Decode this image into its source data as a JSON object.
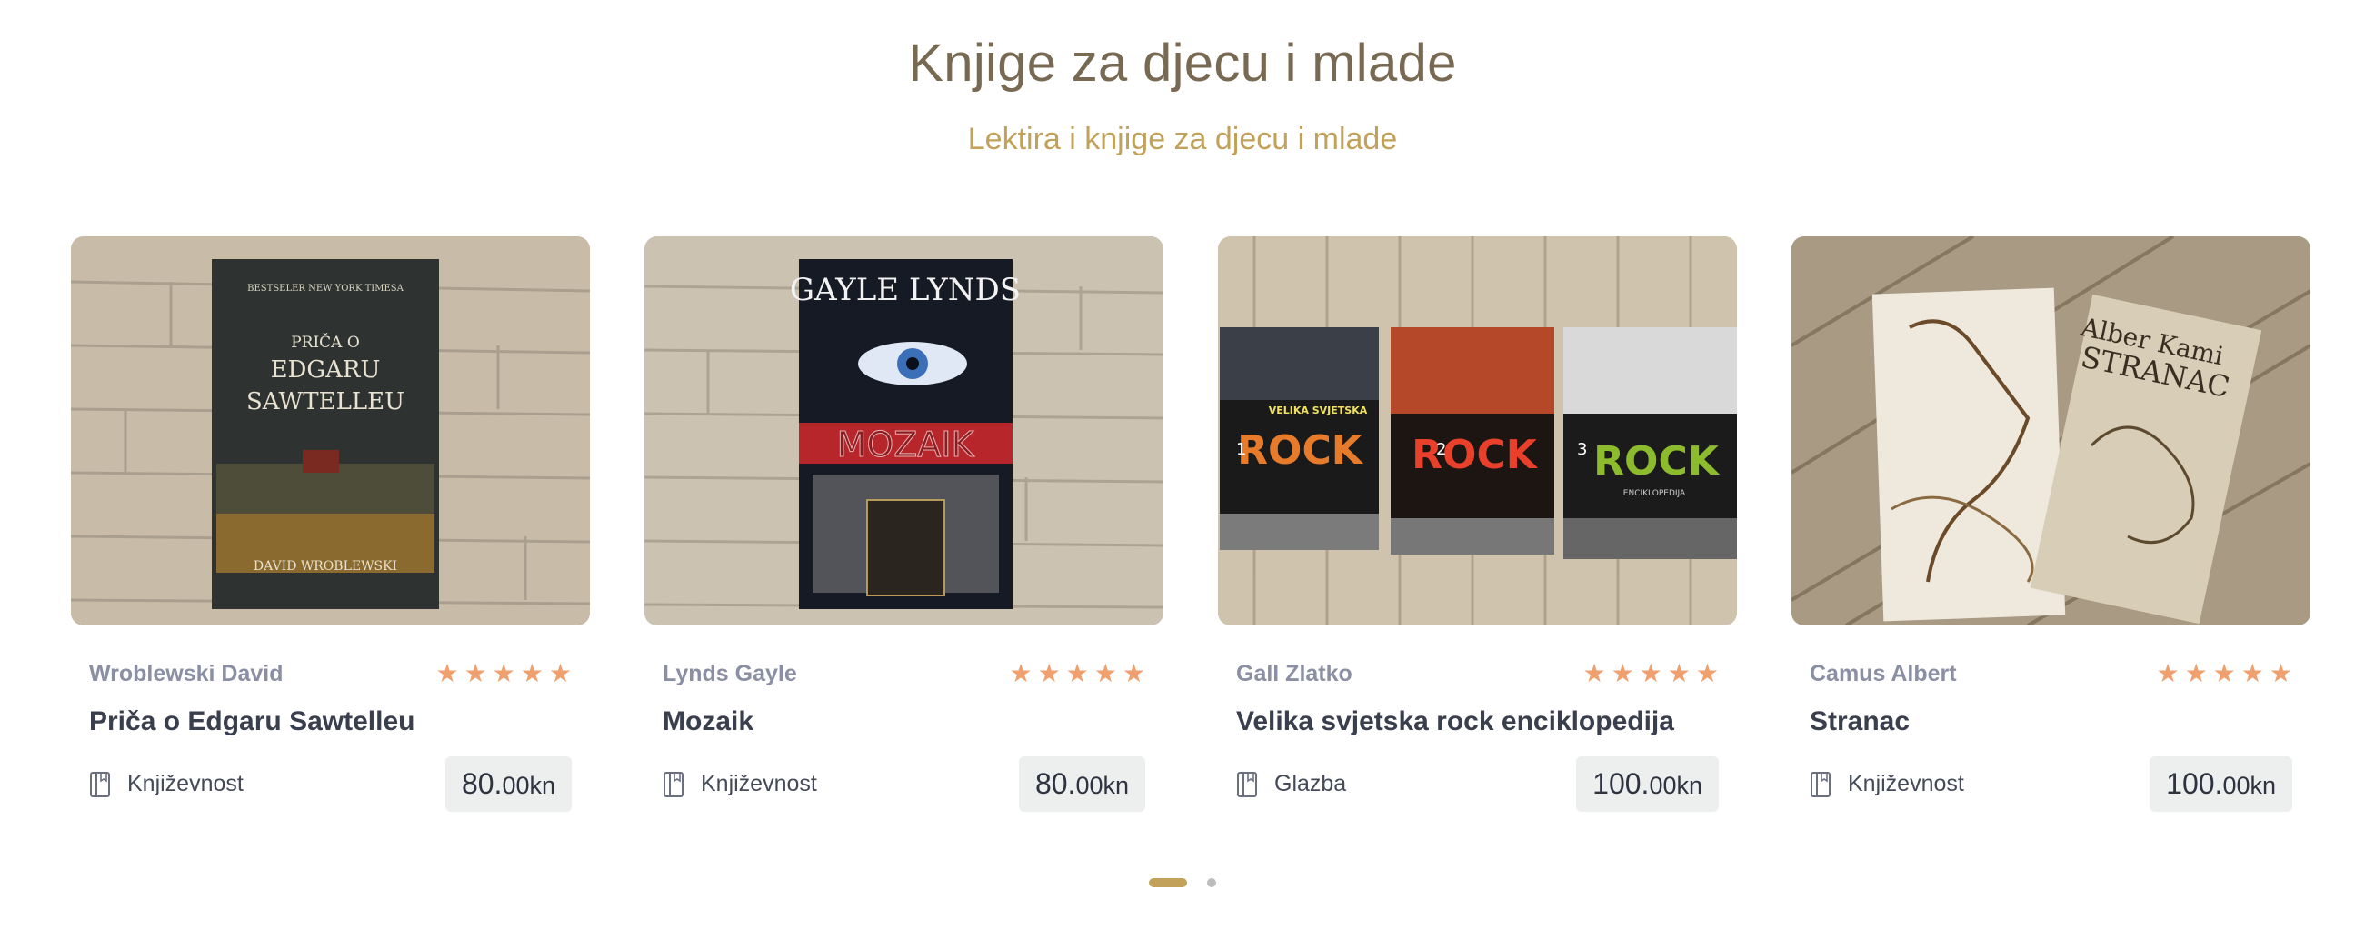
{
  "section": {
    "title": "Knjige za djecu i mlade",
    "subtitle": "Lektira i knjige za djecu i mlade"
  },
  "books": [
    {
      "author": "Wroblewski David",
      "title": "Priča o Edgaru Sawtelleu",
      "category": "Književnost",
      "price_main": "80.",
      "price_dec": "00kn",
      "rating": 5,
      "cover_text": [
        "BESTSELER NEW YORK TIMESA",
        "PRIČA O",
        "EDGARU",
        "SAWTELLEU",
        "DAVID WROBLEWSKI"
      ]
    },
    {
      "author": "Lynds Gayle",
      "title": "Mozaik",
      "category": "Književnost",
      "price_main": "80.",
      "price_dec": "00kn",
      "rating": 5,
      "cover_text": [
        "GAYLE LYNDS",
        "MOZAIK"
      ]
    },
    {
      "author": "Gall Zlatko",
      "title": "Velika svjetska rock enciklopedija",
      "category": "Glazba",
      "price_main": "100.",
      "price_dec": "00kn",
      "rating": 5,
      "cover_text": [
        "VELIKA SVJETSKA",
        "ROCK",
        "ENCIKLOPEDIJA",
        "1",
        "2",
        "3"
      ]
    },
    {
      "author": "Camus Albert",
      "title": "Stranac",
      "category": "Književnost",
      "price_main": "100.",
      "price_dec": "00kn",
      "rating": 5,
      "cover_text": [
        "Alber Kami",
        "STRANAC"
      ]
    }
  ],
  "carousel": {
    "pages": 2,
    "active": 1
  },
  "icons": {
    "star": "star-icon",
    "category": "book-icon"
  },
  "colors": {
    "title": "#786A52",
    "accent": "#C2A25A",
    "star": "#F0A06E"
  }
}
